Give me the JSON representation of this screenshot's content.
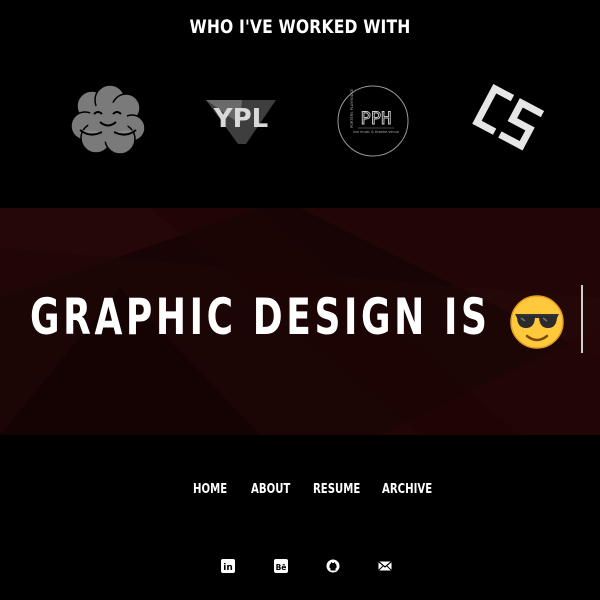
{
  "clients": {
    "title": "WHO I'VE WORKED WITH",
    "logos": [
      {
        "name": "hug-brain-logo"
      },
      {
        "name": "ypl-logo",
        "text": "YPL"
      },
      {
        "name": "pph-logo",
        "text": "PPH",
        "side_text": "PORTERS PLAYHOUSE",
        "sub_text": "live music & theatre venue"
      },
      {
        "name": "cs-logo",
        "text": "CS"
      }
    ]
  },
  "hero": {
    "headline": "GRAPHIC DESIGN IS",
    "emoji": "smiling-face-with-sunglasses",
    "colors": {
      "bg": "#1a0505",
      "accent": "#3a0a0a"
    }
  },
  "nav": {
    "items": [
      {
        "label": "HOME"
      },
      {
        "label": "ABOUT"
      },
      {
        "label": "RESUME"
      },
      {
        "label": "ARCHIVE"
      }
    ]
  },
  "social": [
    {
      "icon": "linkedin-icon",
      "text": "in"
    },
    {
      "icon": "behance-icon",
      "text": "Bē"
    },
    {
      "icon": "github-icon"
    },
    {
      "icon": "mail-icon"
    }
  ]
}
